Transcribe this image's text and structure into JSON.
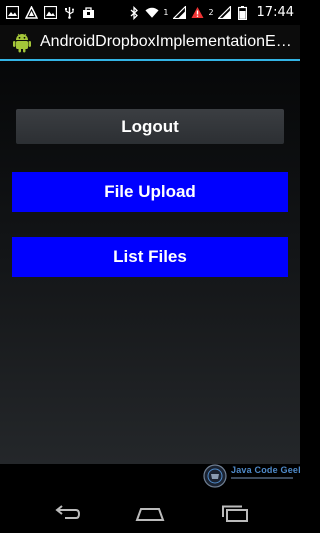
{
  "status_bar": {
    "time": "17:44",
    "sim1_label": "1",
    "sim2_label": "2",
    "icons": [
      "notification-image-icon",
      "signal-outline-icon",
      "image-icon",
      "usb-icon",
      "bag-icon",
      "bluetooth-icon",
      "wifi-icon",
      "sim1-signal-icon",
      "alert-icon",
      "sim2-signal-icon",
      "battery-icon"
    ]
  },
  "action_bar": {
    "title": "AndroidDropboxImplementationExa...",
    "accent_color": "#33b5e5"
  },
  "buttons": {
    "logout": "Logout",
    "file_upload": "File Upload",
    "list_files": "List Files",
    "primary_color": "#0000ff"
  },
  "watermark": {
    "text": "Java Code Geeks"
  },
  "nav_bar": {
    "icons": [
      "back-icon",
      "home-icon",
      "recent-apps-icon"
    ]
  }
}
